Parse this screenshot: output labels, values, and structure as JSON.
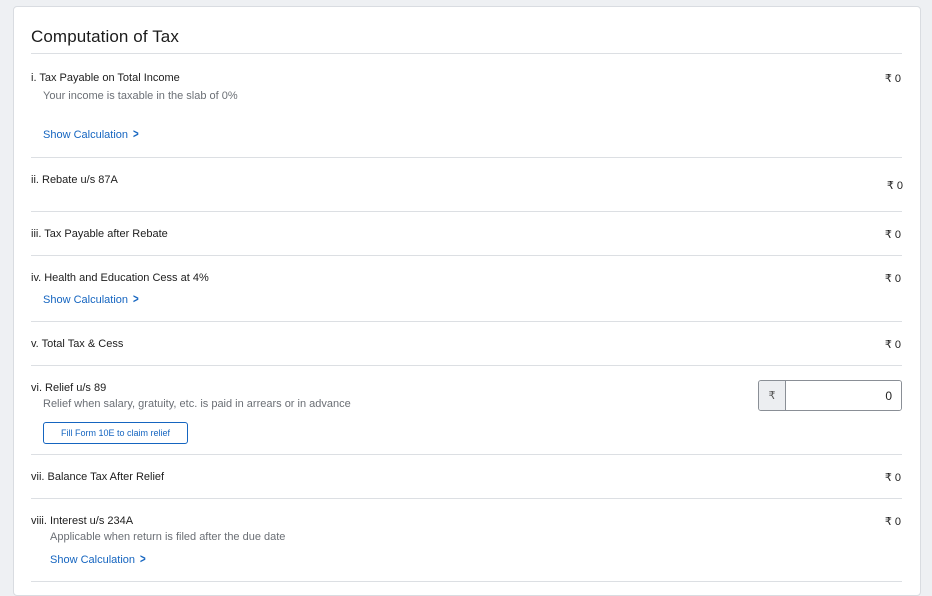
{
  "section": {
    "title": "Computation of Tax"
  },
  "rows": [
    {
      "label": "i. Tax Payable on Total Income",
      "sub": "Your income is taxable in the slab of 0%",
      "amount": "₹ 0",
      "link": "Show Calculation"
    },
    {
      "label": "ii. Rebate u/s 87A",
      "amount": "₹ 0"
    },
    {
      "label": "iii. Tax Payable after Rebate",
      "amount": "₹ 0"
    },
    {
      "label": "iv. Health and Education Cess at 4%",
      "amount": "₹ 0",
      "link": "Show Calculation"
    },
    {
      "label": "v. Total Tax & Cess",
      "amount": "₹ 0"
    },
    {
      "label": "vi. Relief u/s 89",
      "sub": "Relief when salary, gratuity, etc. is paid in arrears or in advance",
      "button": "Fill Form 10E to claim relief",
      "input_prefix": "₹",
      "input_value": "0"
    },
    {
      "label": "vii. Balance Tax After Relief",
      "amount": "₹ 0"
    },
    {
      "label": "viii. Interest u/s 234A",
      "sub": "Applicable when return is filed after the due date",
      "amount": "₹ 0",
      "link": "Show Calculation"
    }
  ],
  "icons": {
    "chevron": "chevron-right-icon"
  },
  "colors": {
    "link": "#1565c0",
    "divider": "#dcdfe3",
    "background": "#eef0f3"
  }
}
